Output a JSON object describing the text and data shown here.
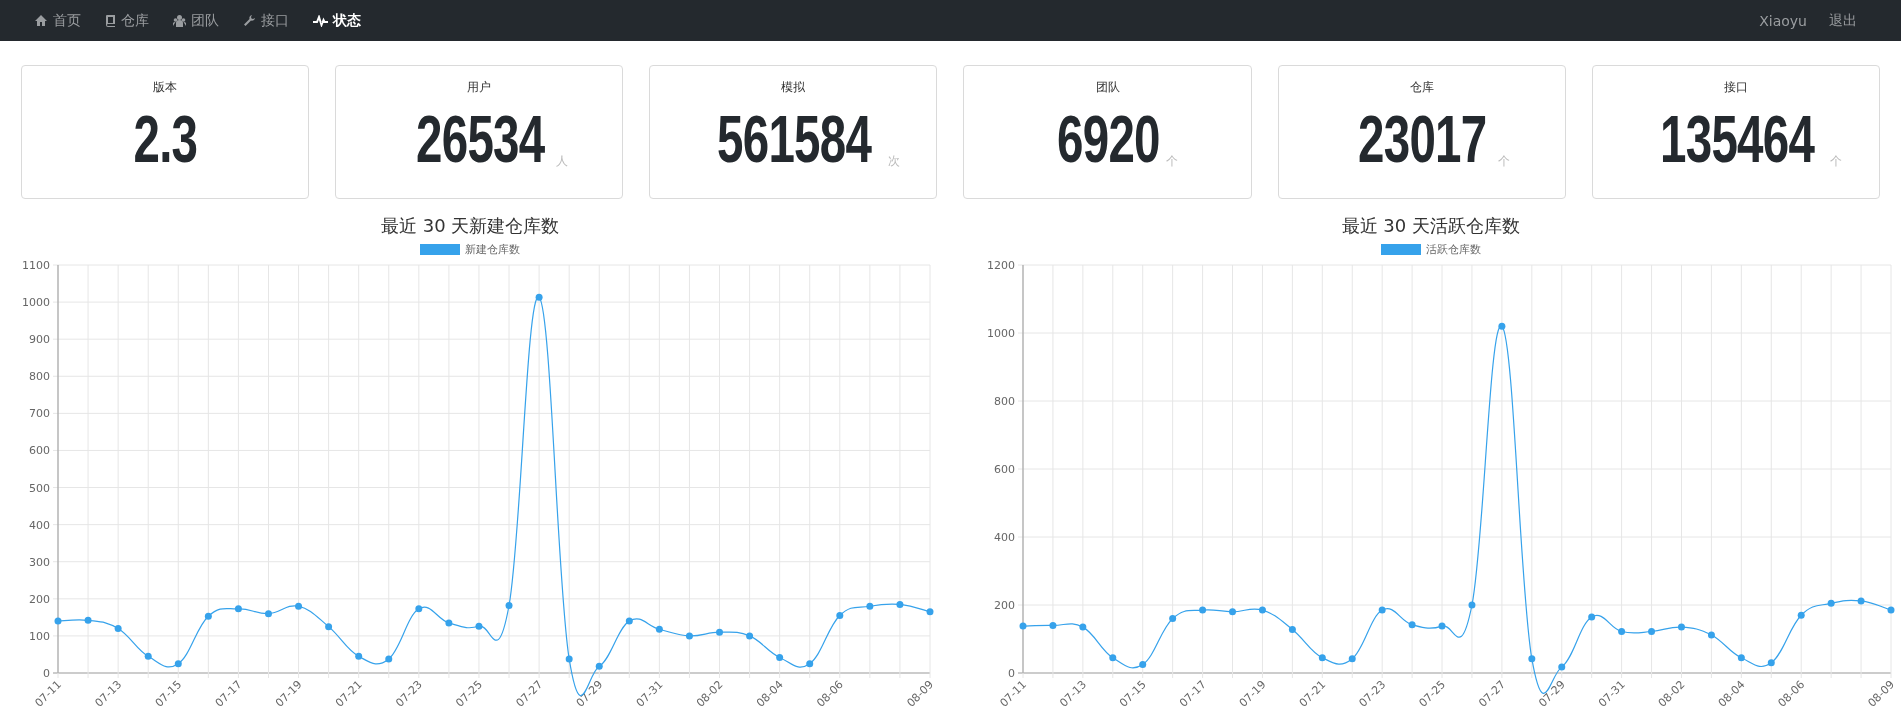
{
  "navbar": {
    "items": [
      {
        "label": "首页",
        "selected": false
      },
      {
        "label": "仓库",
        "selected": false
      },
      {
        "label": "团队",
        "selected": false
      },
      {
        "label": "接口",
        "selected": false
      },
      {
        "label": "状态",
        "selected": true
      }
    ],
    "user": "Xiaoyu",
    "logout": "退出"
  },
  "stats": [
    {
      "label": "版本",
      "value": "2.3"
    },
    {
      "label": "用户",
      "value": "26534",
      "unit": "人"
    },
    {
      "label": "模拟",
      "value": "561584",
      "unit": "次"
    },
    {
      "label": "团队",
      "value": "6920",
      "unit": "个"
    },
    {
      "label": "仓库",
      "value": "23017",
      "unit": "个"
    },
    {
      "label": "接口",
      "value": "135464",
      "unit": "个"
    }
  ],
  "charts": [
    {
      "chart_data": {
        "type": "line",
        "title": "最近 30 天新建仓库数",
        "categories": [
          "07-11",
          null,
          "07-13",
          null,
          "07-15",
          null,
          "07-17",
          null,
          "07-19",
          null,
          "07-21",
          null,
          "07-23",
          null,
          "07-25",
          null,
          "07-27",
          null,
          "07-29",
          null,
          "07-31",
          null,
          "08-02",
          null,
          "08-04",
          null,
          "08-06",
          null,
          null,
          "08-09"
        ],
        "grid": true,
        "series": [
          {
            "name": "新建仓库数",
            "color": "#36a2eb",
            "marker": "circle",
            "values": [
              140,
              142,
              120,
              45,
              25,
              153,
              173,
              160,
              180,
              125,
              45,
              38,
              173,
              135,
              126,
              182,
              1013,
              38,
              18,
              140,
              118,
              100,
              110,
              100,
              42,
              25,
              155,
              180,
              185,
              165
            ]
          }
        ],
        "ylim": [
          0,
          1100
        ],
        "yticks": [
          0,
          100,
          200,
          300,
          400,
          500,
          600,
          700,
          800,
          900,
          1000,
          1100
        ]
      }
    },
    {
      "chart_data": {
        "type": "line",
        "title": "最近 30 天活跃仓库数",
        "categories": [
          "07-11",
          null,
          "07-13",
          null,
          "07-15",
          null,
          "07-17",
          null,
          "07-19",
          null,
          "07-21",
          null,
          "07-23",
          null,
          "07-25",
          null,
          "07-27",
          null,
          "07-29",
          null,
          "07-31",
          null,
          "08-02",
          null,
          "08-04",
          null,
          "08-06",
          null,
          null,
          "08-09"
        ],
        "grid": true,
        "series": [
          {
            "name": "活跃仓库数",
            "color": "#36a2eb",
            "marker": "circle",
            "values": [
              138,
              140,
              135,
              45,
              25,
              160,
              185,
              180,
              185,
              128,
              45,
              42,
              185,
              142,
              138,
              200,
              1020,
              42,
              18,
              165,
              122,
              122,
              135,
              112,
              45,
              30,
              170,
              205,
              212,
              185
            ]
          }
        ],
        "ylim": [
          0,
          1200
        ],
        "yticks": [
          0,
          200,
          400,
          600,
          800,
          1000,
          1200
        ]
      }
    }
  ]
}
